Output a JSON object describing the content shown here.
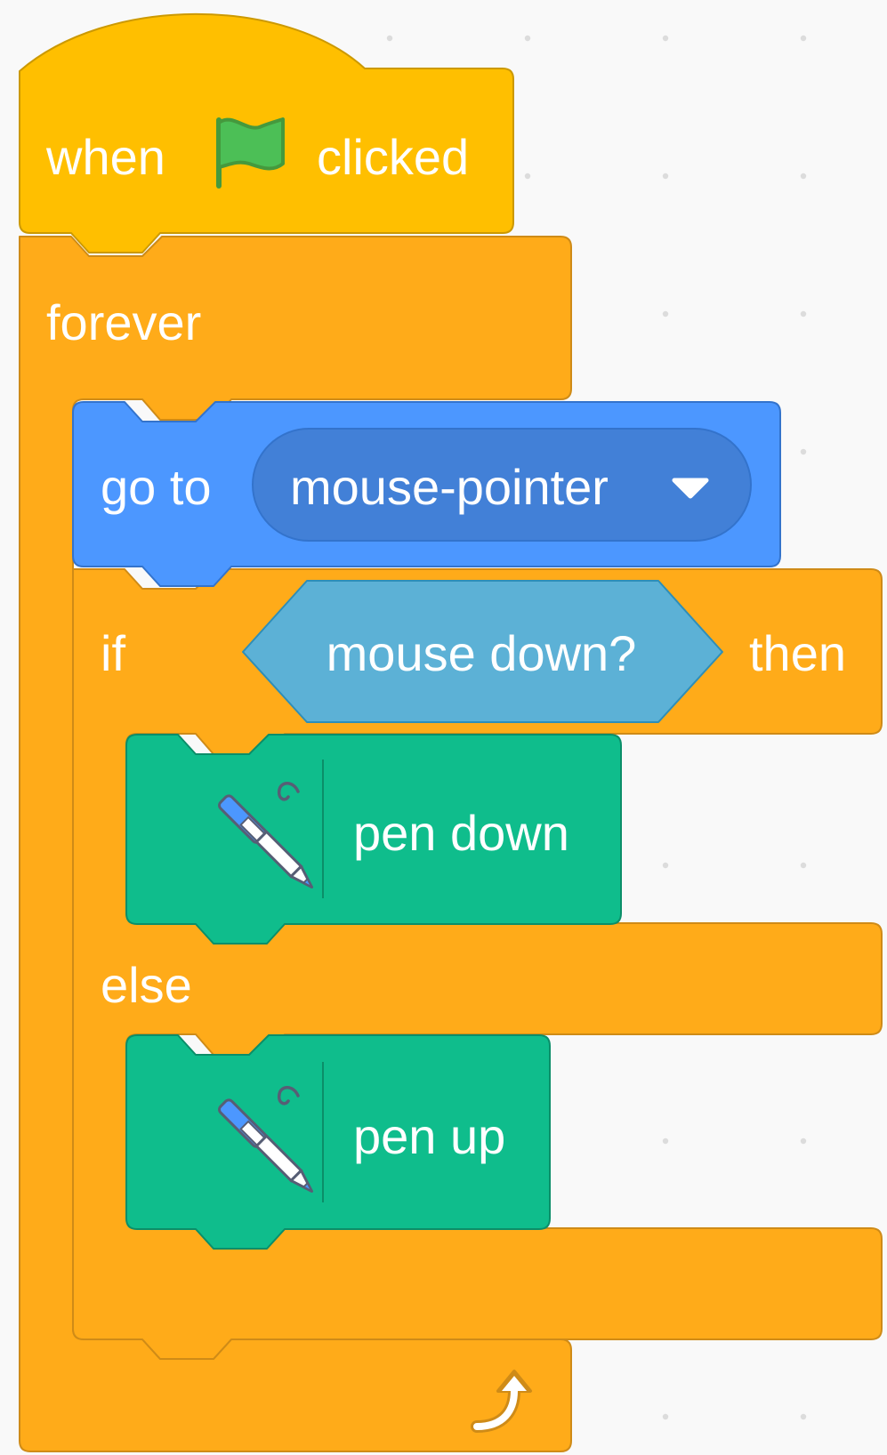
{
  "workspace": {
    "background_color": "#f9f9f9",
    "grid_dot_color": "#dcdcdc"
  },
  "script": {
    "hat_block": {
      "label_before": "when",
      "icon": "green-flag-icon",
      "label_after": "clicked",
      "color": "#ffbf00"
    },
    "forever_block": {
      "label": "forever",
      "loop_icon": "loop-arrow-icon",
      "color": "#ffab19"
    },
    "goto_block": {
      "label": "go to",
      "dropdown_value": "mouse-pointer",
      "dropdown_icon": "caret-down-icon",
      "color": "#4c97ff",
      "dropdown_color": "#4280d7"
    },
    "if_else_block": {
      "if_label": "if",
      "condition_label": "mouse down?",
      "then_label": "then",
      "else_label": "else",
      "color": "#ffab19",
      "condition_color": "#5cb1d6"
    },
    "pen_down_block": {
      "icon": "pen-icon",
      "label": "pen down",
      "color": "#0fbd8c"
    },
    "pen_up_block": {
      "icon": "pen-icon",
      "label": "pen up",
      "color": "#0fbd8c"
    }
  }
}
